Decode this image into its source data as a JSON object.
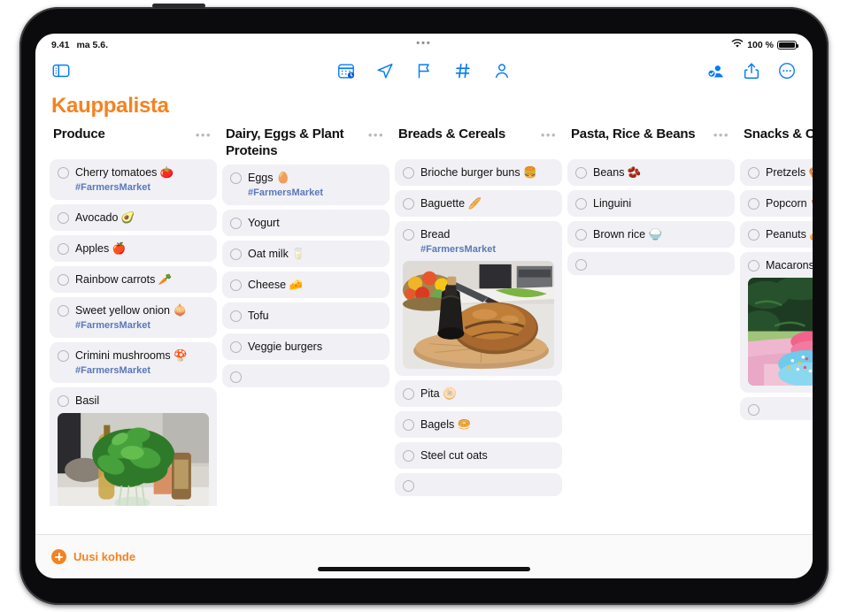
{
  "statusbar": {
    "time": "9.41",
    "date": "ma 5.6.",
    "center_dots": "•••",
    "wifi_icon": "wifi-icon",
    "battery_text": "100 %",
    "battery_icon": "battery-full-icon"
  },
  "toolbar": {
    "sidebar_toggle": "sidebar-toggle-icon",
    "center_icons": [
      {
        "name": "calendar-schedule-icon"
      },
      {
        "name": "location-arrow-icon"
      },
      {
        "name": "flag-icon"
      },
      {
        "name": "hashtag-icon"
      },
      {
        "name": "person-icon"
      }
    ],
    "right_icons": [
      {
        "name": "collaboration-icon"
      },
      {
        "name": "share-icon"
      },
      {
        "name": "more-options-icon"
      }
    ]
  },
  "header": {
    "title": "Kauppalista",
    "menu_glyph": "•••"
  },
  "columns": [
    {
      "title": "Produce",
      "items": [
        {
          "text": "Cherry tomatoes 🍅",
          "tag": "#FarmersMarket"
        },
        {
          "text": "Avocado 🥑"
        },
        {
          "text": "Apples 🍎"
        },
        {
          "text": "Rainbow carrots 🥕"
        },
        {
          "text": "Sweet yellow onion 🧅",
          "tag": "#FarmersMarket"
        },
        {
          "text": "Crimini mushrooms 🍄",
          "tag": "#FarmersMarket"
        },
        {
          "text": "Basil",
          "photo": "basil-photo"
        },
        {
          "text": "",
          "empty": true
        }
      ]
    },
    {
      "title": "Dairy, Eggs & Plant Proteins",
      "items": [
        {
          "text": "Eggs 🥚",
          "tag": "#FarmersMarket"
        },
        {
          "text": "Yogurt"
        },
        {
          "text": "Oat milk 🥛"
        },
        {
          "text": "Cheese 🧀"
        },
        {
          "text": "Tofu"
        },
        {
          "text": "Veggie burgers"
        },
        {
          "text": "",
          "empty": true
        }
      ]
    },
    {
      "title": "Breads & Cereals",
      "items": [
        {
          "text": "Brioche burger buns 🍔"
        },
        {
          "text": "Baguette 🥖"
        },
        {
          "text": "Bread",
          "tag": "#FarmersMarket",
          "photo": "bread-photo"
        },
        {
          "text": "Pita 🫓"
        },
        {
          "text": "Bagels 🥯"
        },
        {
          "text": "Steel cut oats"
        },
        {
          "text": "",
          "empty": true
        }
      ]
    },
    {
      "title": "Pasta, Rice & Beans",
      "items": [
        {
          "text": "Beans 🫘"
        },
        {
          "text": "Linguini"
        },
        {
          "text": "Brown rice 🍚"
        },
        {
          "text": "",
          "empty": true
        }
      ]
    },
    {
      "title": "Snacks & Candy",
      "items": [
        {
          "text": "Pretzels 🥨"
        },
        {
          "text": "Popcorn 🍿"
        },
        {
          "text": "Peanuts 🥜"
        },
        {
          "text": "Macarons",
          "photo": "macarons-photo"
        },
        {
          "text": "",
          "empty": true
        }
      ]
    }
  ],
  "bottombar": {
    "new_item_label": "Uusi kohde",
    "plus_icon": "plus-circle-icon"
  },
  "colors": {
    "accent": "#f58220",
    "tint": "#067cf8",
    "tag": "#5a78b8",
    "item_bg": "#f1f0f5"
  }
}
